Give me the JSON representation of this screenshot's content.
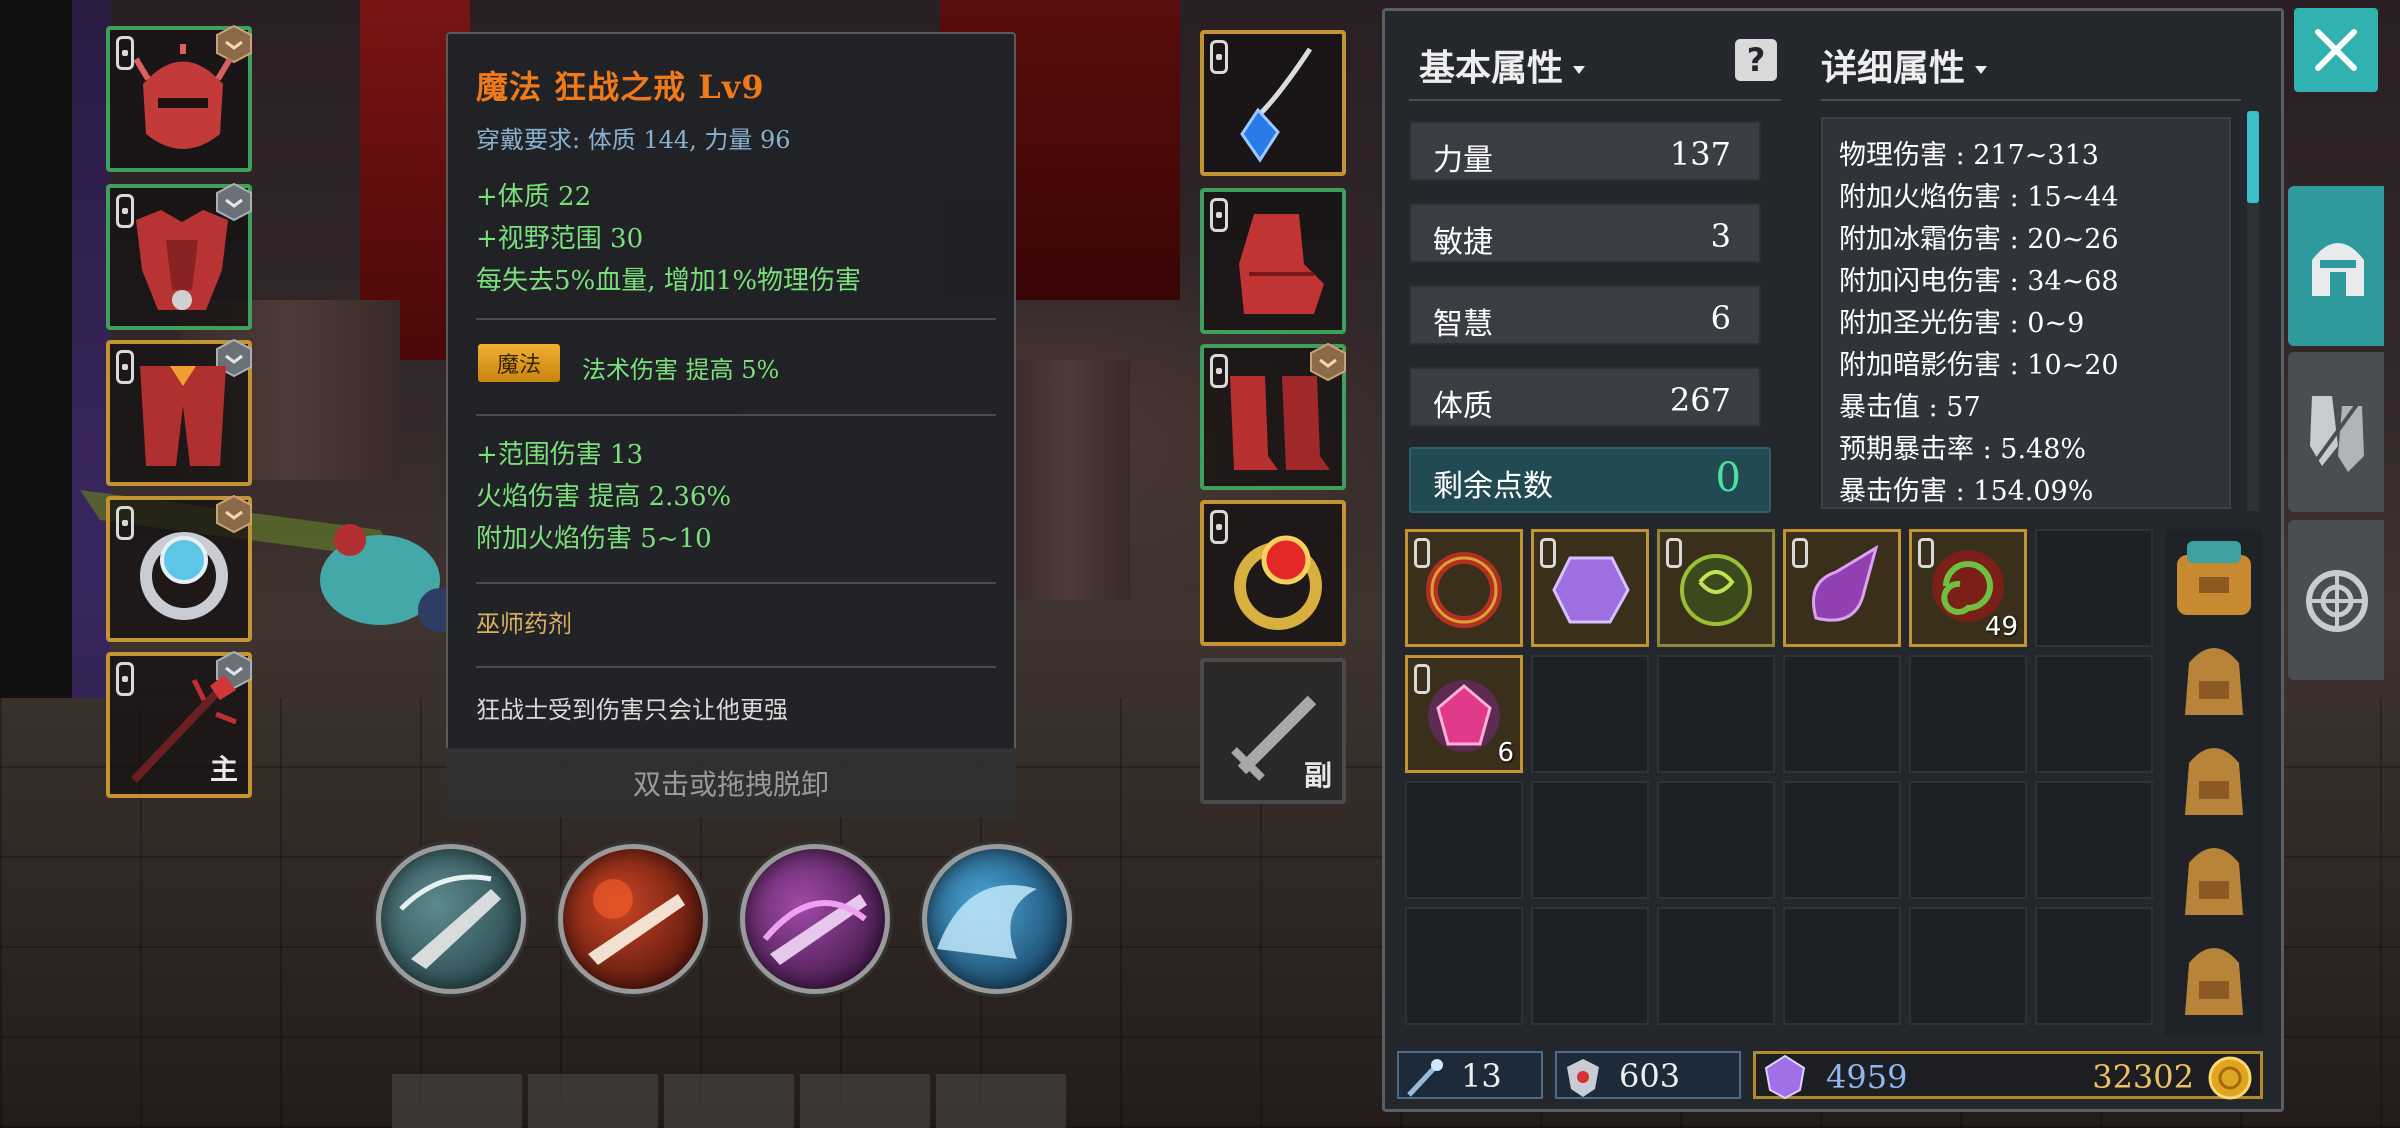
{
  "tooltip": {
    "title": "魔法  狂战之戒  Lv9",
    "requirement": "穿戴要求:  体质 144, 力量 96",
    "stats1": [
      "+体质  22",
      "+视野范围  30",
      "每失去5%血量, 增加1%物理伤害"
    ],
    "magic_badge": "魔法",
    "magic_text": "法术伤害  提高  5%",
    "stats2": [
      "+范围伤害  13",
      "火焰伤害  提高  2.36%",
      "附加火焰伤害  5~10"
    ],
    "potion": "巫师药剂",
    "flavor": "狂战士受到伤害只会让他更强"
  },
  "unequip_hint": "双击或拖拽脱卸",
  "equip_tags": {
    "main": "主",
    "sub": "副"
  },
  "panel": {
    "basic_header": "基本属性",
    "detail_header": "详细属性",
    "help_label": "?",
    "basic_stats": [
      {
        "label": "力量",
        "value": "137"
      },
      {
        "label": "敏捷",
        "value": "3"
      },
      {
        "label": "智慧",
        "value": "6"
      },
      {
        "label": "体质",
        "value": "267"
      }
    ],
    "remaining": {
      "label": "剩余点数",
      "value": "0"
    },
    "detail_stats": [
      "物理伤害  : 217~313",
      "附加火焰伤害  : 15~44",
      "附加冰霜伤害  : 20~26",
      "附加闪电伤害  : 34~68",
      "附加圣光伤害  : 0~9",
      "附加暗影伤害  : 10~20",
      "暴击值  : 57",
      "预期暴击率  : 5.48%",
      "暴击伤害  : 154.09%"
    ],
    "inventory_counts": {
      "scroll": "49",
      "gem": "6"
    },
    "currency": {
      "wand": "13",
      "crest": "603",
      "crystal": "4959",
      "gold": "32302"
    }
  },
  "colors": {
    "accent": "#2fb2b0",
    "orange_title": "#f07a1a",
    "green_text": "#7be07b",
    "gold_border": "#c49433"
  }
}
